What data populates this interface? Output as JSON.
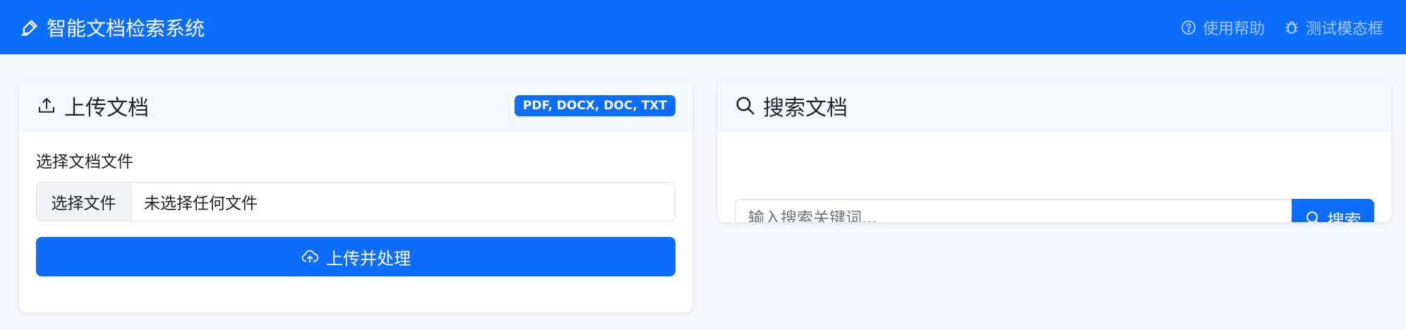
{
  "navbar": {
    "brand_title": "智能文档检索系统",
    "help_link": "使用帮助",
    "test_modal_link": "测试模态框"
  },
  "upload_card": {
    "title": "上传文档",
    "formats_badge": "PDF, DOCX, DOC, TXT",
    "file_label": "选择文档文件",
    "file_button": "选择文件",
    "file_status": "未选择任何文件",
    "submit_label": "上传并处理"
  },
  "search_card": {
    "title": "搜索文档",
    "search_placeholder": "输入搜索关键词...",
    "search_button": "搜索"
  },
  "colors": {
    "primary": "#0d6efd",
    "page_bg": "#f5f7fa",
    "header_bg": "#f5f9fd"
  },
  "icons": {
    "brand": "pen-icon",
    "help": "question-circle-icon",
    "test": "bug-icon",
    "upload": "upload-icon",
    "search": "search-icon",
    "cloud_upload": "cloud-upload-icon"
  }
}
